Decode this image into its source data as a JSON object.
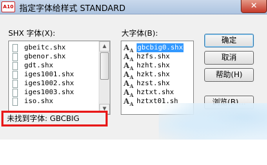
{
  "window": {
    "title": "指定字体给样式 STANDARD",
    "app_icon_text": "A10",
    "close_glyph": "✕"
  },
  "shx_list": {
    "label": "SHX 字体(X):",
    "items": [
      "gbeitc.shx",
      "gbenor.shx",
      "gdt.shx",
      "iges1001.shx",
      "iges1002.shx",
      "iges1003.shx",
      "iso.shx"
    ],
    "icon": "file-icon"
  },
  "bigfont_list": {
    "label": "大字体(B):",
    "items": [
      "gbcbig0.shx",
      "hzfs.shx",
      "hzht.shx",
      "hzkt.shx",
      "hzst.shx",
      "hztxt.shx",
      "hztxt01.sh"
    ],
    "selected_index": 0,
    "icon": "font-icon"
  },
  "buttons": {
    "ok": "确定",
    "cancel": "取消",
    "help": "帮助(H)",
    "browse": "浏览(B)..."
  },
  "status": {
    "text": "未找到字体: GBCBIG",
    "highlight_color": "#e81a1a"
  },
  "colors": {
    "selection": "#3399ff",
    "dialog_bg": "#f0f0f0"
  }
}
